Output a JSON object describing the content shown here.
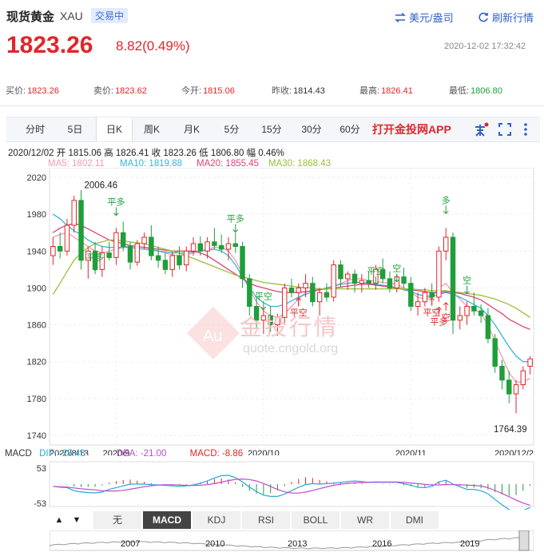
{
  "header": {
    "title": "现货黄金",
    "code": "XAU",
    "status": "交易中",
    "currency_label": "美元/盎司",
    "refresh_label": "刷新行情",
    "price": "1823.26",
    "change": "8.82(0.49%)",
    "timestamp": "2020-12-02 17:32:42"
  },
  "quote": [
    {
      "label": "买价:",
      "value": "1823.26",
      "color": "#e0262a"
    },
    {
      "label": "卖价:",
      "value": "1823.62",
      "color": "#e0262a"
    },
    {
      "label": "今开:",
      "value": "1815.06",
      "color": "#e0262a"
    },
    {
      "label": "昨收:",
      "value": "1814.43",
      "color": "#333333"
    },
    {
      "label": "最高:",
      "value": "1826.41",
      "color": "#e0262a"
    },
    {
      "label": "最低:",
      "value": "1806.80",
      "color": "#1f9e3b"
    }
  ],
  "tabs": [
    "分时",
    "5日",
    "日K",
    "周K",
    "月K",
    "5分",
    "15分",
    "30分",
    "60分"
  ],
  "active_tab": "日K",
  "promo": "打开金投网APP",
  "info_line": "2020/12/02  开 1815.06  高 1826.41  收 1823.26  低 1806.80  幅 0.46%",
  "ma_labels": [
    {
      "text": "MA5: 1802.11",
      "color": "#f29bb4"
    },
    {
      "text": "MA10: 1819.88",
      "color": "#39b4d8"
    },
    {
      "text": "MA20: 1855.45",
      "color": "#e0417a"
    },
    {
      "text": "MA30: 1868.43",
      "color": "#9bbf3a"
    }
  ],
  "watermark": {
    "cn": "金投行情",
    "url": "quote.cngold.org"
  },
  "macd_labels": [
    {
      "text": "MACD",
      "color": "#333333"
    },
    {
      "text": "DIF: -25.43",
      "color": "#29a8d6"
    },
    {
      "text": "DEA: -21.00",
      "color": "#c04ad0"
    },
    {
      "text": "MACD: -8.86",
      "color": "#e0262a"
    }
  ],
  "indicator_tabs": [
    "无",
    "MACD",
    "KDJ",
    "RSI",
    "BOLL",
    "WR",
    "DMI"
  ],
  "active_indicator": "MACD",
  "mini_years": [
    "2007",
    "2010",
    "2013",
    "2016",
    "2019"
  ],
  "chart_data": {
    "type": "candlestick",
    "y_ticks": [
      2020,
      1980,
      1940,
      1900,
      1860,
      1820,
      1780,
      1740
    ],
    "ylim": [
      1740,
      2020
    ],
    "x_labels": [
      "2020/8/13",
      "2020/9",
      "2020/10",
      "2020/11",
      "2020/12/2"
    ],
    "annotations": {
      "high": "2006.46",
      "low": "1764.39",
      "signals": [
        "平多",
        "平多",
        "平多",
        "平空",
        "平空",
        "平空",
        "空",
        "空",
        "空",
        "多",
        "平多",
        "平空",
        "空"
      ]
    },
    "candles_ohlc": [
      [
        1935,
        1955,
        1925,
        1945
      ],
      [
        1945,
        1960,
        1932,
        1940
      ],
      [
        1940,
        1975,
        1935,
        1968
      ],
      [
        1968,
        2000,
        1960,
        1995
      ],
      [
        1995,
        2006,
        1920,
        1930
      ],
      [
        1930,
        1945,
        1910,
        1940
      ],
      [
        1940,
        1950,
        1915,
        1920
      ],
      [
        1920,
        1945,
        1912,
        1938
      ],
      [
        1938,
        1950,
        1930,
        1933
      ],
      [
        1933,
        1965,
        1925,
        1960
      ],
      [
        1960,
        1972,
        1940,
        1945
      ],
      [
        1945,
        1950,
        1920,
        1928
      ],
      [
        1928,
        1952,
        1924,
        1948
      ],
      [
        1948,
        1960,
        1942,
        1955
      ],
      [
        1955,
        1968,
        1930,
        1935
      ],
      [
        1935,
        1945,
        1922,
        1930
      ],
      [
        1930,
        1938,
        1915,
        1920
      ],
      [
        1920,
        1940,
        1912,
        1935
      ],
      [
        1935,
        1945,
        1920,
        1925
      ],
      [
        1925,
        1945,
        1918,
        1940
      ],
      [
        1940,
        1955,
        1935,
        1948
      ],
      [
        1948,
        1956,
        1935,
        1940
      ],
      [
        1940,
        1955,
        1932,
        1950
      ],
      [
        1950,
        1965,
        1942,
        1946
      ],
      [
        1946,
        1958,
        1938,
        1942
      ],
      [
        1942,
        1955,
        1930,
        1948
      ],
      [
        1948,
        1960,
        1938,
        1945
      ],
      [
        1945,
        1950,
        1900,
        1910
      ],
      [
        1910,
        1915,
        1870,
        1880
      ],
      [
        1880,
        1890,
        1855,
        1865
      ],
      [
        1865,
        1878,
        1850,
        1870
      ],
      [
        1870,
        1880,
        1852,
        1860
      ],
      [
        1860,
        1872,
        1848,
        1868
      ],
      [
        1868,
        1905,
        1860,
        1900
      ],
      [
        1900,
        1910,
        1890,
        1895
      ],
      [
        1895,
        1905,
        1880,
        1900
      ],
      [
        1900,
        1915,
        1890,
        1905
      ],
      [
        1905,
        1912,
        1880,
        1885
      ],
      [
        1885,
        1900,
        1870,
        1895
      ],
      [
        1895,
        1905,
        1885,
        1890
      ],
      [
        1890,
        1930,
        1885,
        1925
      ],
      [
        1925,
        1930,
        1900,
        1910
      ],
      [
        1910,
        1918,
        1898,
        1915
      ],
      [
        1915,
        1920,
        1895,
        1905
      ],
      [
        1905,
        1915,
        1895,
        1908
      ],
      [
        1908,
        1918,
        1900,
        1905
      ],
      [
        1905,
        1925,
        1898,
        1920
      ],
      [
        1920,
        1932,
        1905,
        1910
      ],
      [
        1910,
        1918,
        1895,
        1900
      ],
      [
        1900,
        1915,
        1895,
        1912
      ],
      [
        1912,
        1922,
        1900,
        1905
      ],
      [
        1905,
        1912,
        1875,
        1880
      ],
      [
        1880,
        1895,
        1870,
        1885
      ],
      [
        1885,
        1900,
        1880,
        1895
      ],
      [
        1895,
        1905,
        1882,
        1890
      ],
      [
        1890,
        1945,
        1885,
        1940
      ],
      [
        1940,
        1965,
        1930,
        1955
      ],
      [
        1955,
        1960,
        1850,
        1865
      ],
      [
        1865,
        1880,
        1855,
        1870
      ],
      [
        1870,
        1885,
        1860,
        1880
      ],
      [
        1880,
        1895,
        1870,
        1875
      ],
      [
        1875,
        1882,
        1862,
        1870
      ],
      [
        1870,
        1878,
        1840,
        1845
      ],
      [
        1845,
        1850,
        1808,
        1815
      ],
      [
        1815,
        1822,
        1790,
        1800
      ],
      [
        1800,
        1810,
        1775,
        1785
      ],
      [
        1785,
        1800,
        1764,
        1795
      ],
      [
        1795,
        1815,
        1790,
        1810
      ],
      [
        1815,
        1826,
        1806,
        1823
      ]
    ],
    "ma_series": {
      "MA5": [
        1955,
        1958,
        1960,
        1955,
        1950,
        1945,
        1940,
        1938,
        1940,
        1942,
        1944,
        1946,
        1945,
        1944,
        1942,
        1940,
        1938,
        1936,
        1935,
        1936,
        1938,
        1940,
        1942,
        1944,
        1944,
        1940,
        1930,
        1915,
        1898,
        1885,
        1875,
        1870,
        1868,
        1872,
        1880,
        1888,
        1895,
        1898,
        1898,
        1900,
        1902,
        1905,
        1908,
        1910,
        1910,
        1908,
        1907,
        1906,
        1905,
        1904,
        1900,
        1895,
        1890,
        1888,
        1890,
        1900,
        1905,
        1895,
        1888,
        1880,
        1878,
        1872,
        1860,
        1842,
        1825,
        1808,
        1798,
        1798,
        1802
      ],
      "MA10": [
        1980,
        1975,
        1968,
        1962,
        1958,
        1952,
        1948,
        1945,
        1944,
        1944,
        1944,
        1944,
        1943,
        1942,
        1941,
        1940,
        1939,
        1938,
        1938,
        1938,
        1939,
        1940,
        1941,
        1942,
        1940,
        1935,
        1925,
        1912,
        1900,
        1890,
        1884,
        1880,
        1880,
        1882,
        1886,
        1890,
        1893,
        1896,
        1898,
        1900,
        1902,
        1904,
        1905,
        1906,
        1906,
        1905,
        1904,
        1903,
        1902,
        1900,
        1898,
        1896,
        1893,
        1891,
        1891,
        1893,
        1895,
        1893,
        1890,
        1886,
        1882,
        1878,
        1870,
        1860,
        1848,
        1836,
        1826,
        1820,
        1820
      ],
      "MA20": [
        1960,
        1965,
        1968,
        1970,
        1968,
        1964,
        1960,
        1956,
        1952,
        1950,
        1948,
        1946,
        1945,
        1944,
        1943,
        1942,
        1941,
        1940,
        1940,
        1940,
        1940,
        1938,
        1935,
        1930,
        1925,
        1920,
        1915,
        1910,
        1905,
        1902,
        1900,
        1898,
        1896,
        1895,
        1895,
        1895,
        1896,
        1897,
        1898,
        1899,
        1900,
        1901,
        1902,
        1903,
        1904,
        1904,
        1903,
        1902,
        1901,
        1900,
        1899,
        1898,
        1897,
        1896,
        1895,
        1895,
        1896,
        1895,
        1894,
        1892,
        1890,
        1887,
        1882,
        1877,
        1872,
        1866,
        1862,
        1858,
        1855
      ],
      "MA30": [
        1893,
        1905,
        1918,
        1930,
        1938,
        1944,
        1948,
        1950,
        1952,
        1952,
        1951,
        1950,
        1949,
        1948,
        1946,
        1944,
        1942,
        1940,
        1938,
        1935,
        1932,
        1929,
        1926,
        1923,
        1920,
        1917,
        1914,
        1912,
        1910,
        1908,
        1906,
        1905,
        1904,
        1903,
        1902,
        1901,
        1900,
        1900,
        1899,
        1899,
        1899,
        1899,
        1899,
        1899,
        1899,
        1899,
        1899,
        1899,
        1899,
        1899,
        1899,
        1899,
        1898,
        1898,
        1897,
        1897,
        1897,
        1896,
        1895,
        1894,
        1893,
        1892,
        1890,
        1888,
        1885,
        1882,
        1878,
        1873,
        1868
      ]
    }
  }
}
